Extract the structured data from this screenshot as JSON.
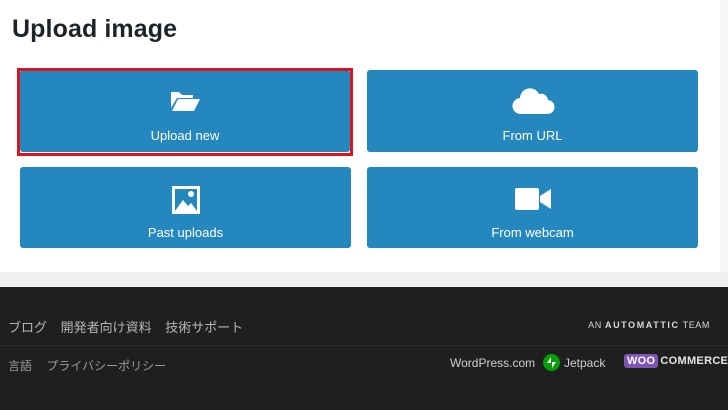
{
  "dialog": {
    "title": "Upload image",
    "tiles": [
      {
        "label": "Upload new",
        "icon": "folder-open-icon",
        "highlighted": true
      },
      {
        "label": "From URL",
        "icon": "cloud-icon"
      },
      {
        "label": "Past uploads",
        "icon": "image-icon"
      },
      {
        "label": "From webcam",
        "icon": "video-camera-icon"
      }
    ],
    "colors": {
      "tile": "#2487bd",
      "highlight": "#d9141e"
    }
  },
  "footer": {
    "links": [
      "ブログ",
      "開発者向け資料",
      "技術サポート"
    ],
    "automattic": {
      "prefix": "AN",
      "name": "AUTOMATTIC",
      "suffix": "TEAM"
    },
    "bottom_links": [
      "言語",
      "プライバシーポリシー"
    ],
    "brands": {
      "wordpress": "WordPress.com",
      "jetpack": "Jetpack",
      "woo": "WOO",
      "commerce": "COMMERCE"
    }
  }
}
